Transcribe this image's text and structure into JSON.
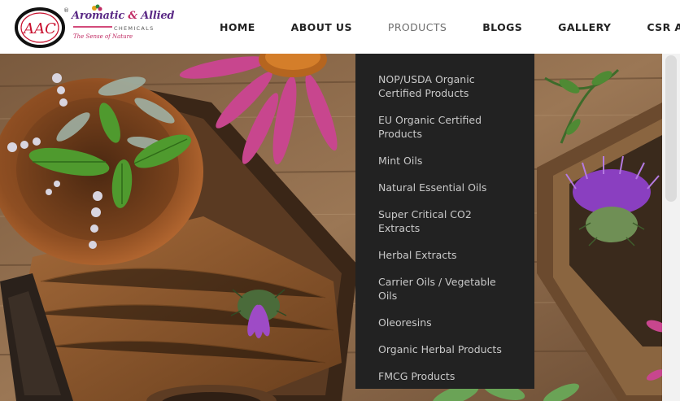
{
  "brand": {
    "emblem_text": "AAC",
    "title_a": "Aromatic",
    "title_amp": "&",
    "title_b": "Allied",
    "registered": "®",
    "subtitle": "CHEMICALS",
    "tagline": "The Sense of Nature"
  },
  "nav": {
    "items": [
      {
        "label": "HOME",
        "active": false
      },
      {
        "label": "ABOUT US",
        "active": false
      },
      {
        "label": "PRODUCTS",
        "active": true
      },
      {
        "label": "BLOGS",
        "active": false
      },
      {
        "label": "GALLERY",
        "active": false
      },
      {
        "label": "CSR ACTIVITY",
        "active": false
      }
    ]
  },
  "products_menu": {
    "items": [
      {
        "label": "NOP/USDA Organic Certified Products"
      },
      {
        "label": "EU Organic Certified Products"
      },
      {
        "label": "Mint Oils"
      },
      {
        "label": "Natural Essential Oils"
      },
      {
        "label": "Super Critical CO2 Extracts"
      },
      {
        "label": "Herbal Extracts"
      },
      {
        "label": "Carrier Oils / Vegetable Oils"
      },
      {
        "label": "Oleoresins"
      },
      {
        "label": "Organic Herbal Products"
      },
      {
        "label": "FMCG Products"
      }
    ]
  },
  "colors": {
    "menu_bg": "#222222",
    "menu_text": "#c9c9c9",
    "nav_text": "#222222",
    "nav_active": "#6e6e6e",
    "brand_purple": "#5b2a86",
    "brand_pink": "#c02a63",
    "emblem_red": "#c8102e"
  }
}
